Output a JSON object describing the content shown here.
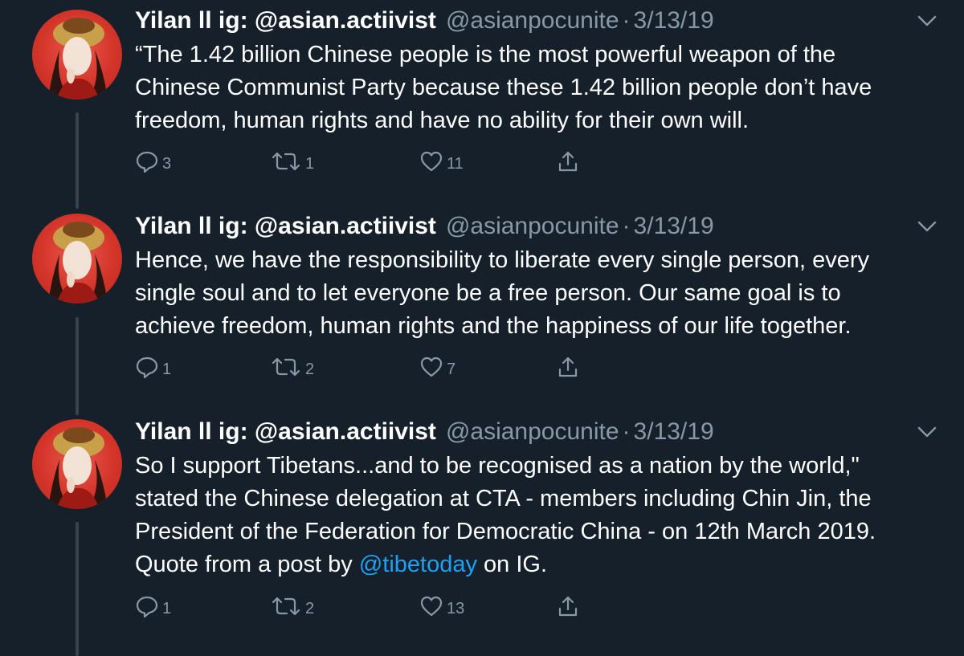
{
  "tweets": [
    {
      "name": "Yilan ll ig: @asian.actiivist",
      "handle": "@asianpocunite",
      "separator": "·",
      "date": "3/13/19",
      "text": "“The 1.42 billion Chinese people is the most powerful weapon of the\nChinese Communist Party because these 1.42 billion people don’t have\nfreedom, human rights and have no ability for their own will.",
      "replies": "3",
      "retweets": "1",
      "likes": "11"
    },
    {
      "name": "Yilan ll ig: @asian.actiivist",
      "handle": "@asianpocunite",
      "separator": "·",
      "date": "3/13/19",
      "text": "Hence, we have the responsibility to liberate every single person, every\nsingle soul and to let everyone be a free person. Our same goal is to\nachieve freedom, human rights and the happiness of our life together.",
      "replies": "1",
      "retweets": "2",
      "likes": "7"
    },
    {
      "name": "Yilan ll ig: @asian.actiivist",
      "handle": "@asianpocunite",
      "separator": "·",
      "date": "3/13/19",
      "text_before": "So I support Tibetans...and to be recognised as a nation by the world,\"\nstated the Chinese delegation at CTA - members including Chin Jin, the\nPresident of the Federation for Democratic China - on 12th March 2019.\nQuote from a post by ",
      "mention": "@tibetoday",
      "text_after": " on IG.",
      "replies": "1",
      "retweets": "2",
      "likes": "13"
    }
  ],
  "icons": {
    "reply": "reply-icon",
    "retweet": "retweet-icon",
    "like": "heart-icon",
    "share": "share-icon",
    "menu": "chevron-down-icon"
  },
  "colors": {
    "background": "#15202b",
    "secondary_text": "#8899a6",
    "link": "#1da1f2",
    "thread_line": "#38444d"
  }
}
